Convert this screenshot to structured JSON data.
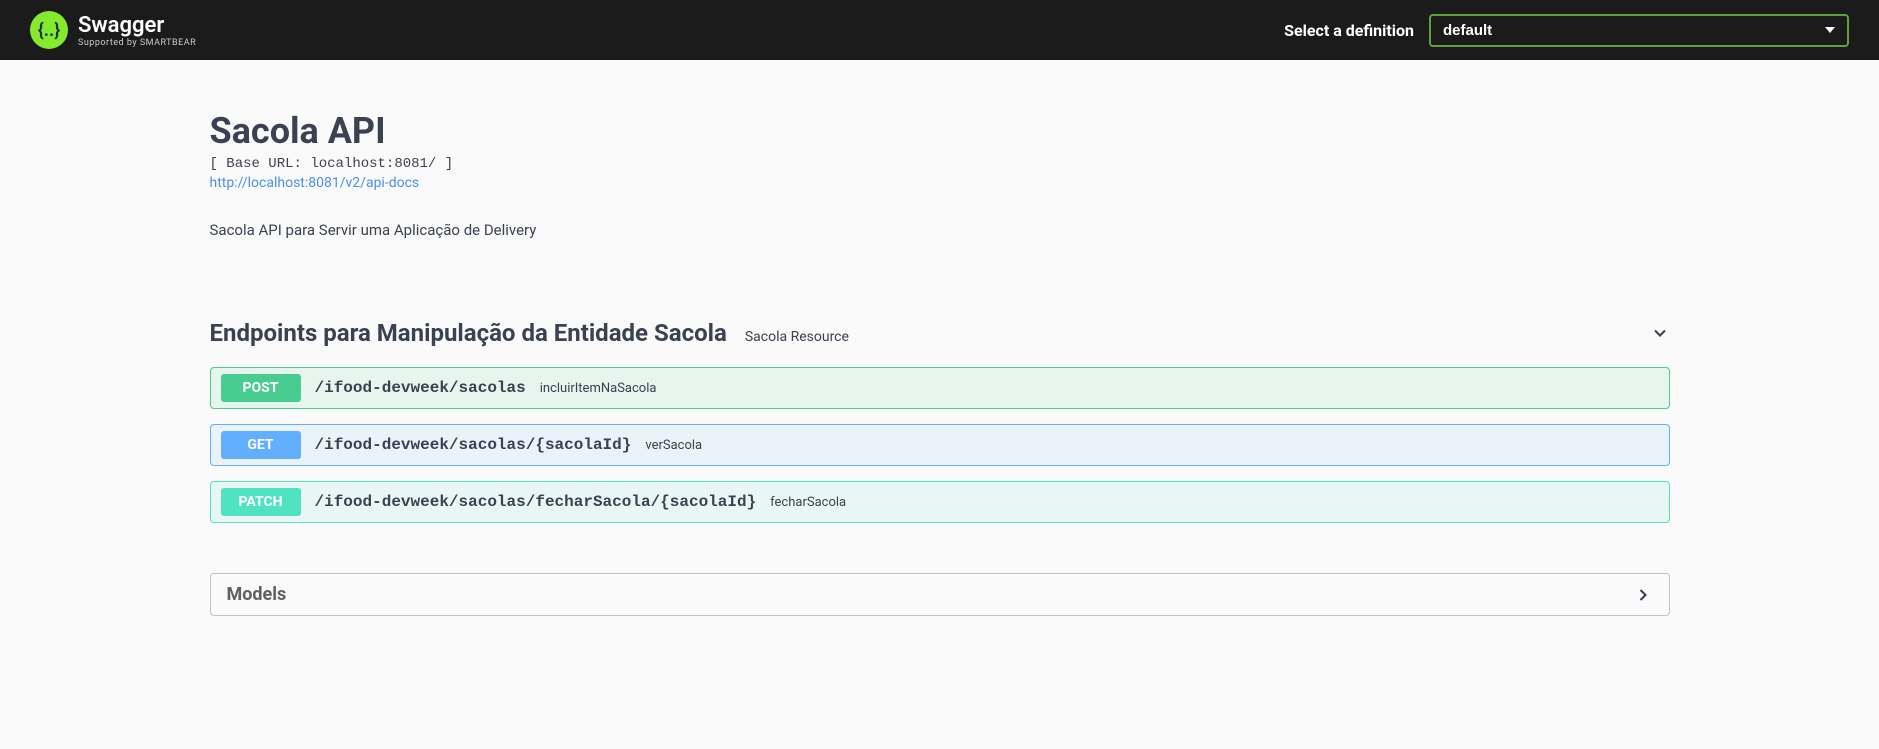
{
  "topbar": {
    "logo_text": "Swagger",
    "logo_sub": "Supported by SMARTBEAR",
    "select_label": "Select a definition",
    "definition_value": "default"
  },
  "info": {
    "title": "Sacola API",
    "base_url": "[ Base URL: localhost:8081/ ]",
    "docs_url": "http://localhost:8081/v2/api-docs",
    "description": "Sacola API para Servir uma Aplicação de Delivery"
  },
  "tag": {
    "name": "Endpoints para Manipulação da Entidade Sacola",
    "description": "Sacola Resource",
    "operations": [
      {
        "method": "POST",
        "method_class": "post",
        "path": "/ifood-devweek/sacolas",
        "summary": "incluirItemNaSacola"
      },
      {
        "method": "GET",
        "method_class": "get",
        "path": "/ifood-devweek/sacolas/{sacolaId}",
        "summary": "verSacola"
      },
      {
        "method": "PATCH",
        "method_class": "patch",
        "path": "/ifood-devweek/sacolas/fecharSacola/{sacolaId}",
        "summary": "fecharSacola"
      }
    ]
  },
  "models": {
    "title": "Models"
  }
}
